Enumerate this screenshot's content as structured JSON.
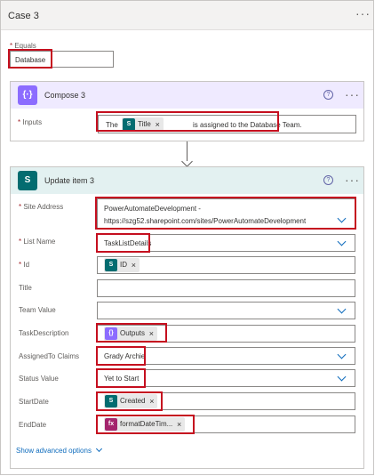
{
  "case": {
    "title": "Case 3",
    "equals_label": "Equals",
    "equals_value": "Database"
  },
  "compose": {
    "title": "Compose 3",
    "inputs_label": "Inputs",
    "text_before": "The",
    "token_label": "Title",
    "text_after": "is assigned to the Database Team."
  },
  "update": {
    "title": "Update item 3",
    "fields": {
      "site_address_label": "Site Address",
      "site_address_line1": "PowerAutomateDevelopment -",
      "site_address_line2": "https://szg52.sharepoint.com/sites/PowerAutomateDevelopment",
      "list_name_label": "List Name",
      "list_name_value": "TaskListDetails",
      "id_label": "Id",
      "id_token": "ID",
      "title_label": "Title",
      "team_value_label": "Team Value",
      "task_description_label": "TaskDescription",
      "task_description_token": "Outputs",
      "assigned_to_label": "AssignedTo Claims",
      "assigned_to_value": "Grady Archie",
      "status_value_label": "Status Value",
      "status_value": "Yet to Start",
      "start_date_label": "StartDate",
      "start_date_token": "Created",
      "end_date_label": "EndDate",
      "end_date_token": "formatDateTim..."
    },
    "show_advanced": "Show advanced options"
  },
  "icons": {
    "compose": "curly-braces-icon",
    "sharepoint": "sharepoint-icon",
    "expression": "fx-icon"
  },
  "colors": {
    "compose_header": "#efeaff",
    "compose_accent": "#8c6cff",
    "sharepoint_header": "#e3f1f1",
    "sharepoint_accent": "#036c70",
    "expression_accent": "#a4256d",
    "highlight": "#c50f1f",
    "link": "#0f6cbd"
  }
}
